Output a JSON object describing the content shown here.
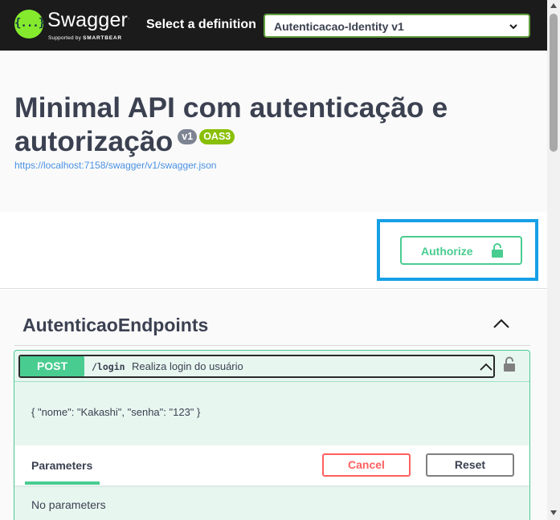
{
  "topbar": {
    "brand_name": "Swagger",
    "brand_tm": ".",
    "brand_sub_prefix": "Supported by",
    "brand_sub_name": "SMARTBEAR",
    "logo_glyph": "{...}",
    "select_label": "Select a definition",
    "selected_definition": "Autenticacao-Identity v1",
    "logo_icon": "swagger-logo-icon",
    "colors": {
      "background": "#1b1b1b",
      "select_border": "#62a03f",
      "logo": "#85ea2d"
    }
  },
  "info": {
    "title": "Minimal API com autenticação e autorização",
    "version_badge": "v1",
    "oas_badge": "OAS3",
    "spec_url": "https://localhost:7158/swagger/v1/swagger.json",
    "colors": {
      "version_badge": "#7d8492",
      "oas_badge": "#89bf04",
      "link": "#4990e2"
    }
  },
  "auth": {
    "authorize_label": "Authorize",
    "lock_icon": "unlocked-lock-icon",
    "colors": {
      "button": "#49cc90",
      "highlight": "#16a0e6"
    }
  },
  "tag": {
    "name": "AutenticaoEndpoints",
    "expanded": true,
    "operations": [
      {
        "method": "POST",
        "path": "/login",
        "summary": "Realiza login do usuário",
        "description": "{ \"nome\": \"Kakashi\", \"senha\": \"123\" }",
        "expanded": true,
        "parameters_tab": "Parameters",
        "cancel_label": "Cancel",
        "reset_label": "Reset",
        "no_parameters": "No parameters",
        "colors": {
          "method": "#49cc90",
          "block_bg": "#e8f6f0",
          "cancel": "#ff6060"
        }
      }
    ]
  }
}
